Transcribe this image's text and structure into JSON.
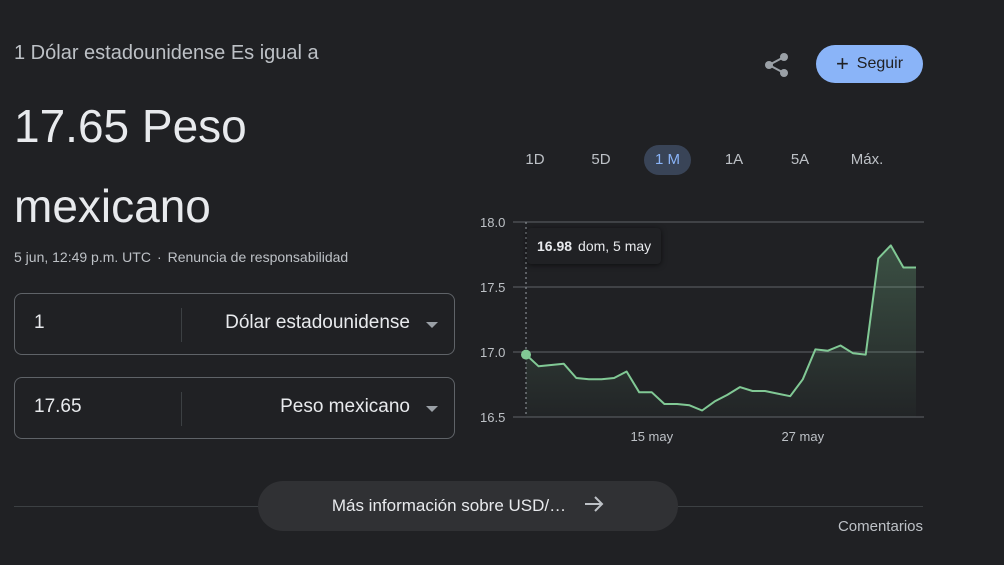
{
  "header": {
    "subtitle": "1 Dólar estadounidense Es igual a",
    "rate_value": "17.65 Peso mexicano",
    "timestamp": "5 jun, 12:49 p.m. UTC",
    "separator": "·",
    "disclaimer": "Renuncia de responsabilidad"
  },
  "actions": {
    "share_icon": "share-icon",
    "follow_label": "Seguir",
    "follow_icon": "+"
  },
  "converter": {
    "from": {
      "amount": "1",
      "currency": "Dólar estadounidense"
    },
    "to": {
      "amount": "17.65",
      "currency": "Peso mexicano"
    }
  },
  "range_tabs": [
    {
      "label": "1D",
      "active": false
    },
    {
      "label": "5D",
      "active": false
    },
    {
      "label": "1 M",
      "active": true
    },
    {
      "label": "1A",
      "active": false
    },
    {
      "label": "5A",
      "active": false
    },
    {
      "label": "Máx.",
      "active": false
    }
  ],
  "tooltip": {
    "value": "16.98",
    "date": "dom, 5 may"
  },
  "chart_data": {
    "type": "area",
    "yticks": [
      "18.0",
      "17.5",
      "17.0",
      "16.5"
    ],
    "ylim": [
      16.5,
      18.0
    ],
    "xlabels": [
      {
        "label": "15 may",
        "day": 15
      },
      {
        "label": "27 may",
        "day": 27
      }
    ],
    "series": [
      {
        "x": [
          5,
          6,
          7,
          8,
          9,
          10,
          11,
          12,
          13,
          14,
          15,
          16,
          17,
          18,
          19,
          20,
          21,
          22,
          23,
          24,
          25,
          26,
          27,
          28,
          29,
          30,
          31,
          32,
          33,
          34,
          35,
          36
        ],
        "y": [
          16.98,
          16.89,
          16.9,
          16.91,
          16.8,
          16.79,
          16.79,
          16.8,
          16.85,
          16.69,
          16.69,
          16.6,
          16.6,
          16.59,
          16.55,
          16.62,
          16.67,
          16.73,
          16.7,
          16.7,
          16.68,
          16.66,
          16.79,
          17.02,
          17.01,
          17.05,
          16.99,
          16.98,
          17.72,
          17.82,
          17.65,
          17.65
        ]
      }
    ],
    "colors": {
      "line": "#81c995",
      "grid": "#5f6368"
    }
  },
  "footer": {
    "more_label": "Más información sobre USD/…",
    "more_icon": "arrow-right-icon",
    "comments_label": "Comentarios"
  }
}
